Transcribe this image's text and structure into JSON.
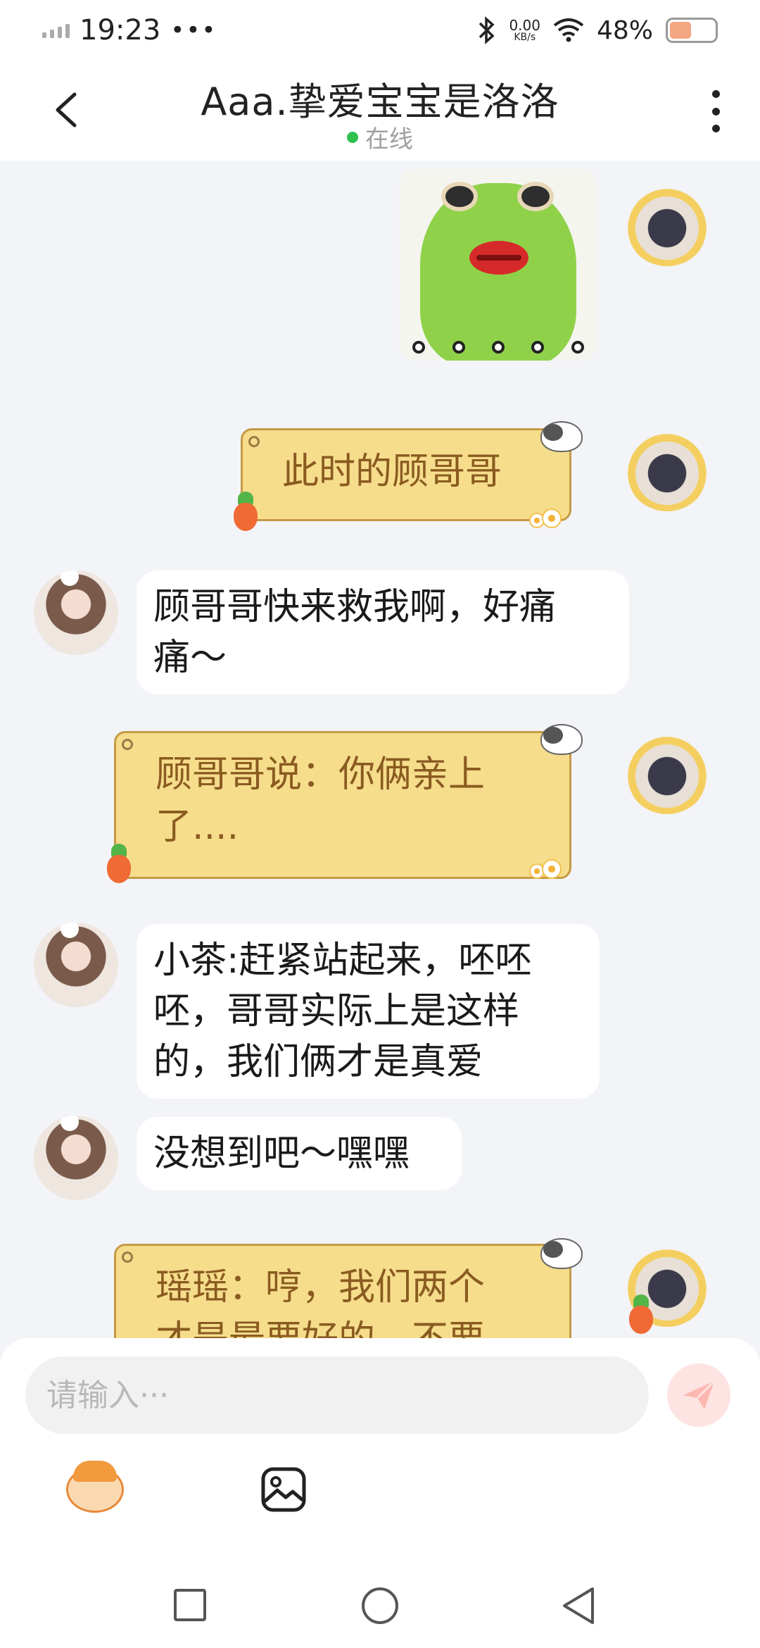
{
  "status_bar": {
    "time": "19:23",
    "dots": "•••",
    "net_speed_value": "0.00",
    "net_speed_unit": "KB/s",
    "battery_percent": "48%",
    "battery_level": 0.48
  },
  "header": {
    "title": "Aaa.挚爱宝宝是洛洛",
    "status": "在线",
    "status_color": "#2fc14e"
  },
  "messages": [
    {
      "side": "right",
      "type": "sticker",
      "icon": "frog-sticker"
    },
    {
      "side": "right",
      "type": "styled",
      "text": "此时的顾哥哥"
    },
    {
      "side": "left",
      "type": "plain",
      "text": "顾哥哥快来救我啊，好痛痛～"
    },
    {
      "side": "right",
      "type": "styled",
      "text": "顾哥哥说：你俩亲上了...."
    },
    {
      "side": "left",
      "type": "plain",
      "text": "小茶:赶紧站起来，呸呸呸，哥哥实际上是这样的，我们俩才是真爱"
    },
    {
      "side": "left",
      "type": "plain",
      "text": "没想到吧～嘿嘿"
    },
    {
      "side": "right",
      "type": "styled",
      "text": "瑶瑶：哼，我们两个才是最要好的，不要"
    }
  ],
  "message_lines": {
    "m2_l1": "此时的顾哥哥",
    "m3_l1": "顾哥哥快来救我啊，好痛",
    "m3_l2": "痛～",
    "m4_l1": "顾哥哥说：你俩亲上",
    "m4_l2": "了....",
    "m5_l1": "小茶:赶紧站起来，呸呸",
    "m5_l2": "呸，哥哥实际上是这样",
    "m5_l3": "的，我们俩才是真爱",
    "m6_l1": "没想到吧～嘿嘿",
    "m7_l1": "瑶瑶：哼，我们两个",
    "m7_l2": "才是最要好的，不要"
  },
  "input": {
    "placeholder": "请输入···"
  },
  "toolbar": {
    "emoji_icon": "emoji-mascot-icon",
    "image_icon": "image-icon",
    "send_icon": "send-icon"
  },
  "colors": {
    "bubble_yellow": "#f6dd8c",
    "bubble_yellow_text": "#8a5b20",
    "chat_background": "#f2f4f8"
  }
}
